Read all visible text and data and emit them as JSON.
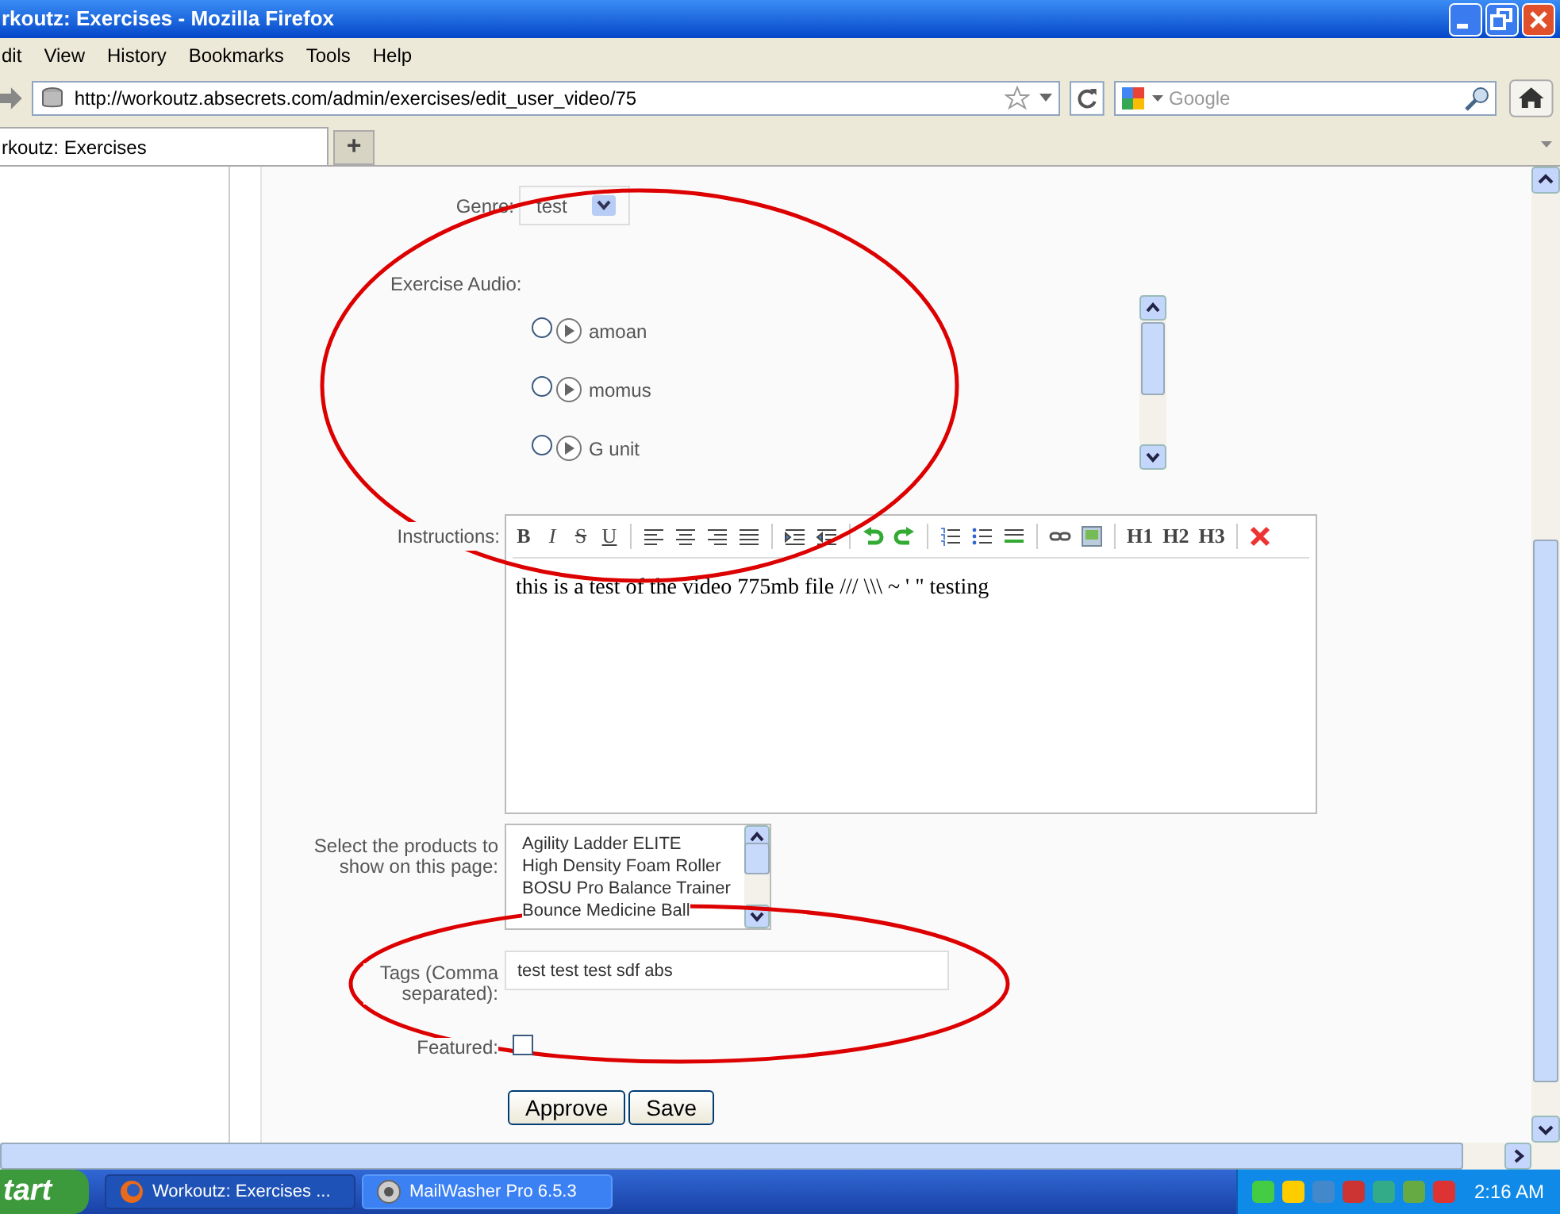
{
  "window": {
    "title": "rkoutz: Exercises - Mozilla Firefox"
  },
  "menu": [
    "dit",
    "View",
    "History",
    "Bookmarks",
    "Tools",
    "Help"
  ],
  "address_bar": {
    "value": "http://workoutz.absecrets.com/admin/exercises/edit_user_video/75"
  },
  "search": {
    "placeholder": "Google"
  },
  "tabs": [
    {
      "label": "rkoutz: Exercises",
      "selected": true
    }
  ],
  "new_tab": "+",
  "form": {
    "genre": {
      "label": "Genre:",
      "value": "test"
    },
    "audio": {
      "label": "Exercise Audio:",
      "items": [
        {
          "name": "amoan",
          "selected": false
        },
        {
          "name": "momus",
          "selected": false
        },
        {
          "name": "G unit",
          "selected": false
        }
      ]
    },
    "instructions": {
      "label": "Instructions:",
      "toolbar": [
        {
          "kind": "text",
          "label": "B"
        },
        {
          "kind": "text",
          "label": "I"
        },
        {
          "kind": "text",
          "label": "S"
        },
        {
          "kind": "text",
          "label": "U"
        },
        {
          "kind": "sep"
        },
        {
          "kind": "alignleft"
        },
        {
          "kind": "aligncenter"
        },
        {
          "kind": "alignright"
        },
        {
          "kind": "justify"
        },
        {
          "kind": "sep"
        },
        {
          "kind": "indent"
        },
        {
          "kind": "outdent"
        },
        {
          "kind": "sep"
        },
        {
          "kind": "undo"
        },
        {
          "kind": "redo"
        },
        {
          "kind": "sep"
        },
        {
          "kind": "olist"
        },
        {
          "kind": "ulist"
        },
        {
          "kind": "rule"
        },
        {
          "kind": "sep"
        },
        {
          "kind": "link"
        },
        {
          "kind": "image"
        },
        {
          "kind": "sep"
        },
        {
          "kind": "text",
          "label": "H1"
        },
        {
          "kind": "text",
          "label": "H2"
        },
        {
          "kind": "text",
          "label": "H3"
        },
        {
          "kind": "sep"
        },
        {
          "kind": "remove"
        }
      ],
      "value": "this is a test of the video 775mb file /// \\\\\\ ~ ' \" testing"
    },
    "products": {
      "label": "Select the products to show on this page:",
      "items": [
        "Agility Ladder ELITE",
        "High Density Foam Roller",
        "BOSU Pro Balance Trainer",
        "Bounce Medicine Ball"
      ]
    },
    "tags": {
      "label": "Tags (Comma separated):",
      "value": "test test test sdf abs"
    },
    "featured": {
      "label": "Featured:",
      "checked": false
    },
    "buttons": [
      "Approve",
      "Save"
    ]
  },
  "taskbar": {
    "start": "tart",
    "tasks": [
      {
        "label": "Workoutz: Exercises ...",
        "selected": true
      },
      {
        "label": "MailWasher Pro 6.5.3",
        "selected": false
      }
    ],
    "clock": "2:16 AM"
  }
}
